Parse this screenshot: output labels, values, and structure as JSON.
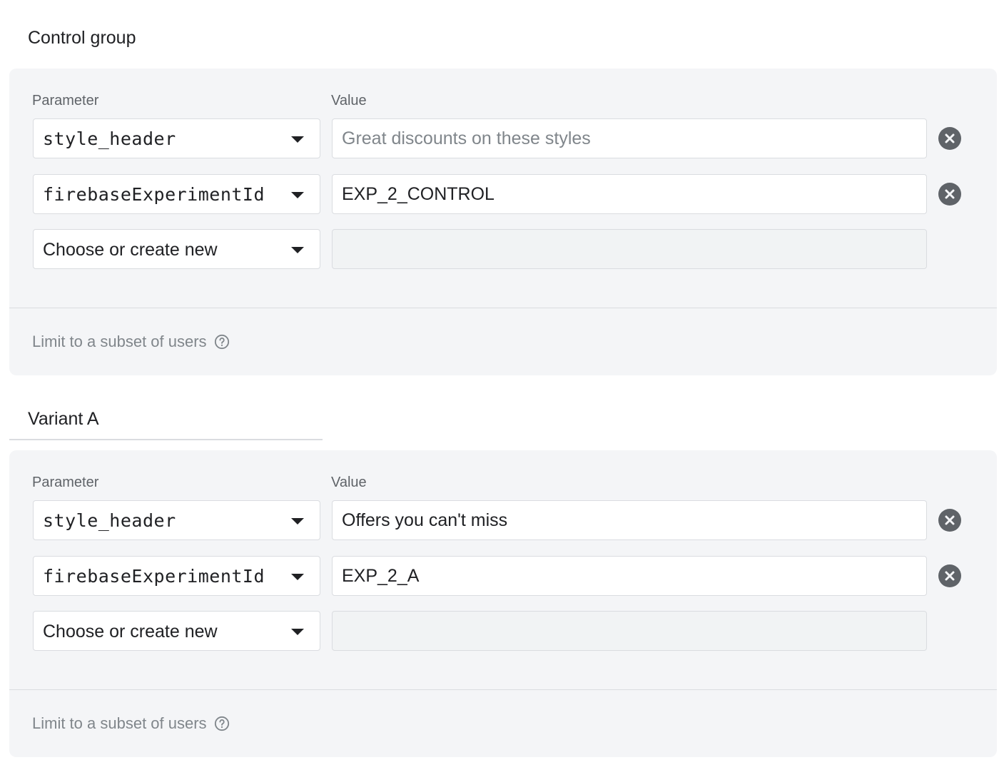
{
  "groups": [
    {
      "title": "Control group",
      "param_label": "Parameter",
      "value_label": "Value",
      "rows": [
        {
          "parameter": "style_header",
          "value": "",
          "placeholder": "Great discounts on these styles"
        },
        {
          "parameter": "firebaseExperimentId",
          "value": "EXP_2_CONTROL",
          "placeholder": ""
        },
        {
          "parameter": "Choose or create new",
          "value": "",
          "placeholder": ""
        }
      ],
      "subset_link": "Limit to a subset of users"
    },
    {
      "title": "Variant A",
      "param_label": "Parameter",
      "value_label": "Value",
      "rows": [
        {
          "parameter": "style_header",
          "value": "Offers you can't miss",
          "placeholder": ""
        },
        {
          "parameter": "firebaseExperimentId",
          "value": "EXP_2_A",
          "placeholder": ""
        },
        {
          "parameter": "Choose or create new",
          "value": "",
          "placeholder": ""
        }
      ],
      "subset_link": "Limit to a subset of users"
    }
  ],
  "icons": {
    "dropdown": "arrow-drop-down-icon",
    "remove": "cancel-circle-icon",
    "help": "help-outline-icon"
  },
  "colors": {
    "panel_bg": "#f4f5f7",
    "remove_icon": "#5f6368",
    "muted_text": "#80868b"
  }
}
